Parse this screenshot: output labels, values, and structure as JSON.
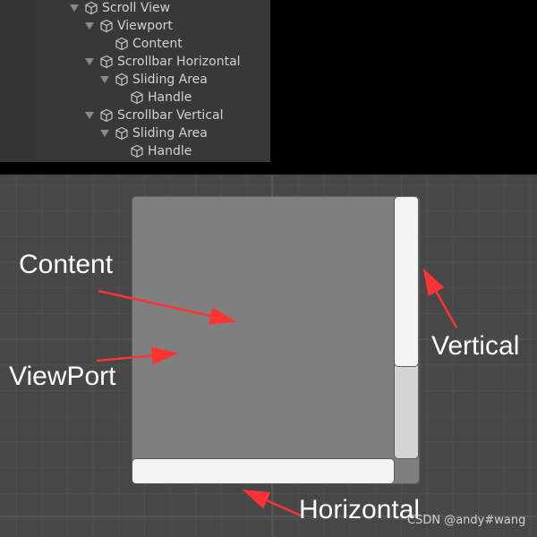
{
  "hierarchy": {
    "items": [
      {
        "label": "Scroll View",
        "depth": 0,
        "expanded": true
      },
      {
        "label": "Viewport",
        "depth": 1,
        "expanded": true
      },
      {
        "label": "Content",
        "depth": 2,
        "expanded": null
      },
      {
        "label": "Scrollbar Horizontal",
        "depth": 1,
        "expanded": true
      },
      {
        "label": "Sliding Area",
        "depth": 2,
        "expanded": true
      },
      {
        "label": "Handle",
        "depth": 3,
        "expanded": null
      },
      {
        "label": "Scrollbar Vertical",
        "depth": 1,
        "expanded": true
      },
      {
        "label": "Sliding Area",
        "depth": 2,
        "expanded": true
      },
      {
        "label": "Handle",
        "depth": 3,
        "expanded": null
      }
    ],
    "icon": "gameobject-cube-icon"
  },
  "annotations": {
    "content": "Content",
    "viewport": "ViewPort",
    "vertical": "Vertical",
    "horizontal": "Horizontal",
    "arrow_color": "#ff3333"
  },
  "watermark": "CSDN @andy#wang"
}
